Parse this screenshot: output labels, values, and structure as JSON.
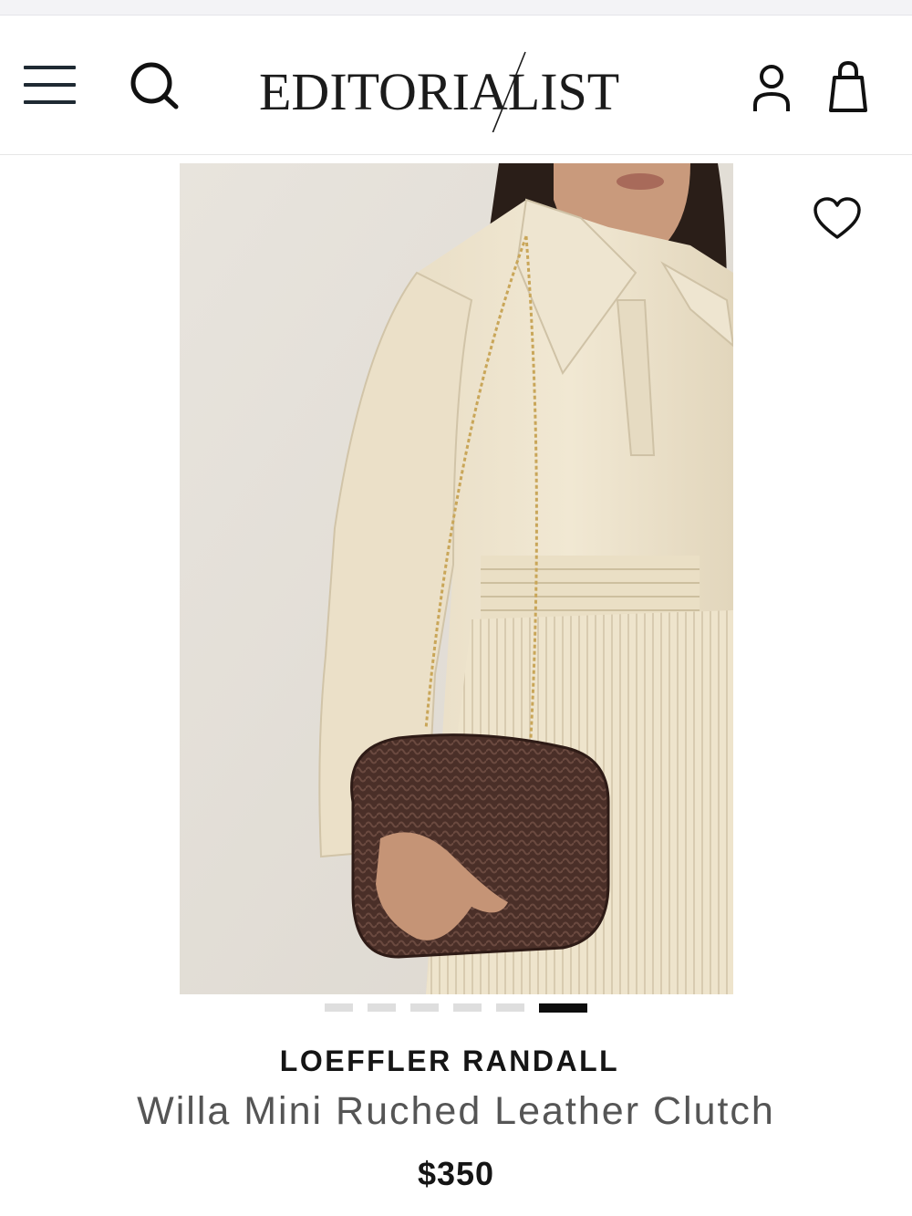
{
  "header": {
    "logo_text": "EDITORIALIST",
    "icons": {
      "menu": "hamburger-menu-icon",
      "search": "search-icon",
      "account": "user-account-icon",
      "bag": "shopping-bag-icon"
    }
  },
  "product": {
    "brand": "LOEFFLER RANDALL",
    "name": "Willa Mini Ruched Leather Clutch",
    "price": "$350",
    "wishlist_icon": "heart-icon",
    "carousel": {
      "total": 6,
      "active_index": 6
    }
  },
  "colors": {
    "background": "#ffffff",
    "text_primary": "#151515",
    "text_secondary": "#555555",
    "dot_active": "#0d0d0d",
    "dot_inactive": "#dedede"
  }
}
